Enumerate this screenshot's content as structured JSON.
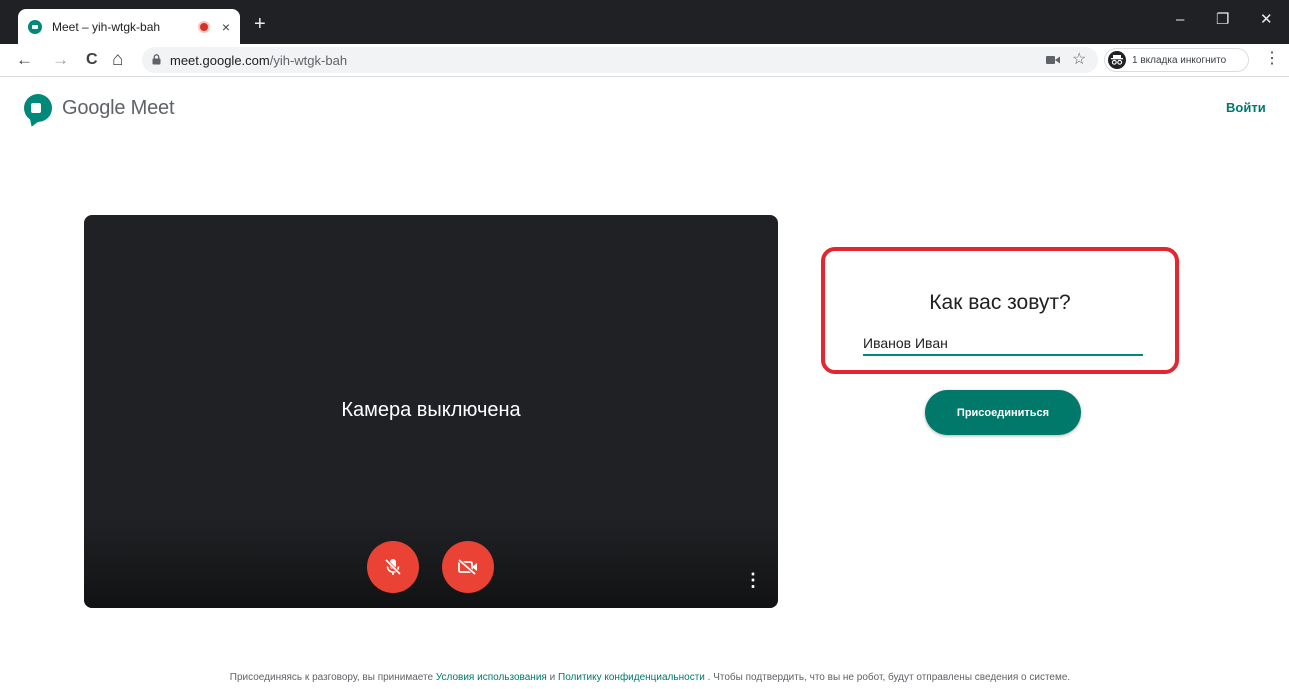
{
  "browser": {
    "tab_title": "Meet – yih-wtgk-bah",
    "tab_close": "×",
    "new_tab": "+",
    "window_controls": {
      "minimize": "–",
      "restore": "❐",
      "close": "✕"
    },
    "nav": {
      "back": "←",
      "forward": "→",
      "reload": "C",
      "home": "⌂"
    },
    "url_host": "meet.google.com",
    "url_path": "/yih-wtgk-bah",
    "bookmark_star": "☆",
    "incognito_label": "1 вкладка инкогнито",
    "menu": "⋮"
  },
  "header": {
    "logo_text": "Google Meet",
    "signin_label": "Войти"
  },
  "preview": {
    "camera_status": "Камера выключена",
    "more_options": "⋮",
    "mic_button": "mic-off-icon",
    "camera_button": "videocam-off-icon"
  },
  "join": {
    "prompt": "Как вас зовут?",
    "name_value": "Иванов Иван",
    "join_label": "Присоединиться"
  },
  "footer": {
    "text_before": "Присоединяясь к разговору, вы принимаете ",
    "terms_link": "Условия использования",
    "and": " и ",
    "privacy_link": "Политику конфиденциальности",
    "text_after": " . Чтобы подтвердить, что вы не робот, будут отправлены сведения о системе."
  },
  "colors": {
    "accent": "#00796b",
    "danger": "#ea4335",
    "highlight_border": "#e32630",
    "preview_bg": "#202124"
  }
}
